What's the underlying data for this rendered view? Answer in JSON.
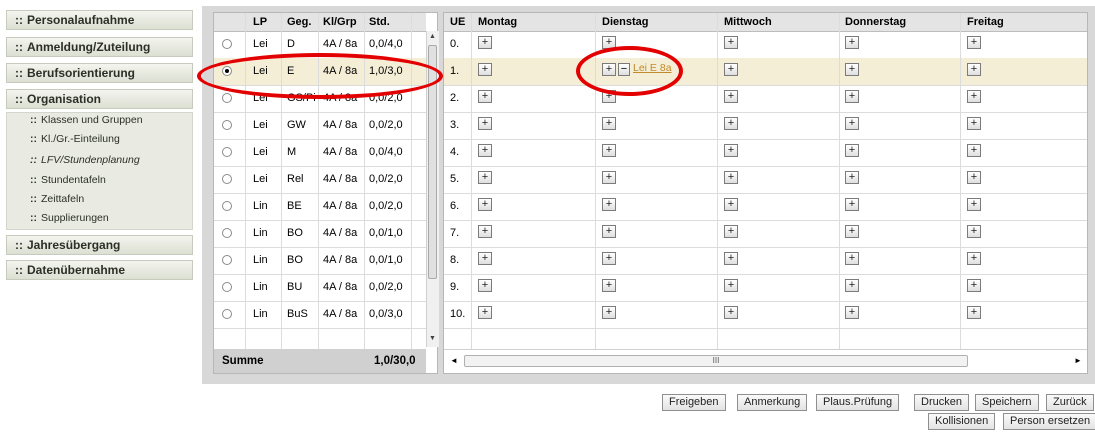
{
  "sidebar": {
    "items": [
      {
        "label": "Personalaufnahme"
      },
      {
        "label": "Anmeldung/Zuteilung"
      },
      {
        "label": "Berufsorientierung"
      },
      {
        "label": "Organisation"
      },
      {
        "label": "Jahresübergang"
      },
      {
        "label": "Datenübernahme"
      }
    ],
    "subitems": [
      {
        "label": "Klassen und Gruppen"
      },
      {
        "label": "Kl./Gr.-Einteilung"
      },
      {
        "label": "LFV/Stundenplanung"
      },
      {
        "label": "Stundentafeln"
      },
      {
        "label": "Zeittafeln"
      },
      {
        "label": "Supplierungen"
      }
    ],
    "bullet": "::"
  },
  "left_table": {
    "headers": {
      "lp": "LP",
      "geg": "Geg.",
      "klgrp": "Kl/Grp",
      "std": "Std."
    },
    "rows": [
      {
        "lp": "Lei",
        "geg": "D",
        "klgrp": "4A / 8a",
        "std": "0,0/4,0",
        "selected": false
      },
      {
        "lp": "Lei",
        "geg": "E",
        "klgrp": "4A / 8a",
        "std": "1,0/3,0",
        "selected": true
      },
      {
        "lp": "Lei",
        "geg": "GS/Pi",
        "klgrp": "4A / 8a",
        "std": "0,0/2,0",
        "selected": false
      },
      {
        "lp": "Lei",
        "geg": "GW",
        "klgrp": "4A / 8a",
        "std": "0,0/2,0",
        "selected": false
      },
      {
        "lp": "Lei",
        "geg": "M",
        "klgrp": "4A / 8a",
        "std": "0,0/4,0",
        "selected": false
      },
      {
        "lp": "Lei",
        "geg": "Rel",
        "klgrp": "4A / 8a",
        "std": "0,0/2,0",
        "selected": false
      },
      {
        "lp": "Lin",
        "geg": "BE",
        "klgrp": "4A / 8a",
        "std": "0,0/2,0",
        "selected": false
      },
      {
        "lp": "Lin",
        "geg": "BO",
        "klgrp": "4A / 8a",
        "std": "0,0/1,0",
        "selected": false
      },
      {
        "lp": "Lin",
        "geg": "BO",
        "klgrp": "4A / 8a",
        "std": "0,0/1,0",
        "selected": false
      },
      {
        "lp": "Lin",
        "geg": "BU",
        "klgrp": "4A / 8a",
        "std": "0,0/2,0",
        "selected": false
      },
      {
        "lp": "Lin",
        "geg": "BuS",
        "klgrp": "4A / 8a",
        "std": "0,0/3,0",
        "selected": false
      }
    ],
    "summary": {
      "label": "Summe",
      "value": "1,0/30,0"
    }
  },
  "schedule": {
    "headers": {
      "ue": "UE",
      "days": [
        "Montag",
        "Dienstag",
        "Mittwoch",
        "Donnerstag",
        "Freitag"
      ]
    },
    "periods": [
      "0.",
      "1.",
      "2.",
      "3.",
      "4.",
      "5.",
      "6.",
      "7.",
      "8.",
      "9.",
      "10."
    ],
    "plus_glyph": "+",
    "minus_glyph": "−",
    "assigned_lesson": {
      "label": "Lei E 8a",
      "day": "Dienstag",
      "period": "1."
    },
    "scroll_glyph": "III"
  },
  "buttons": {
    "freigeben": "Freigeben",
    "anmerkung": "Anmerkung",
    "plaus": "Plaus.Prüfung",
    "drucken": "Drucken",
    "speichern": "Speichern",
    "zurueck": "Zurück",
    "kollisionen": "Kollisionen",
    "person_ersetzen": "Person ersetzen"
  },
  "colors": {
    "highlight_row": "#f4eed6",
    "annotation_red": "#e30000",
    "link": "#c28a2b"
  }
}
